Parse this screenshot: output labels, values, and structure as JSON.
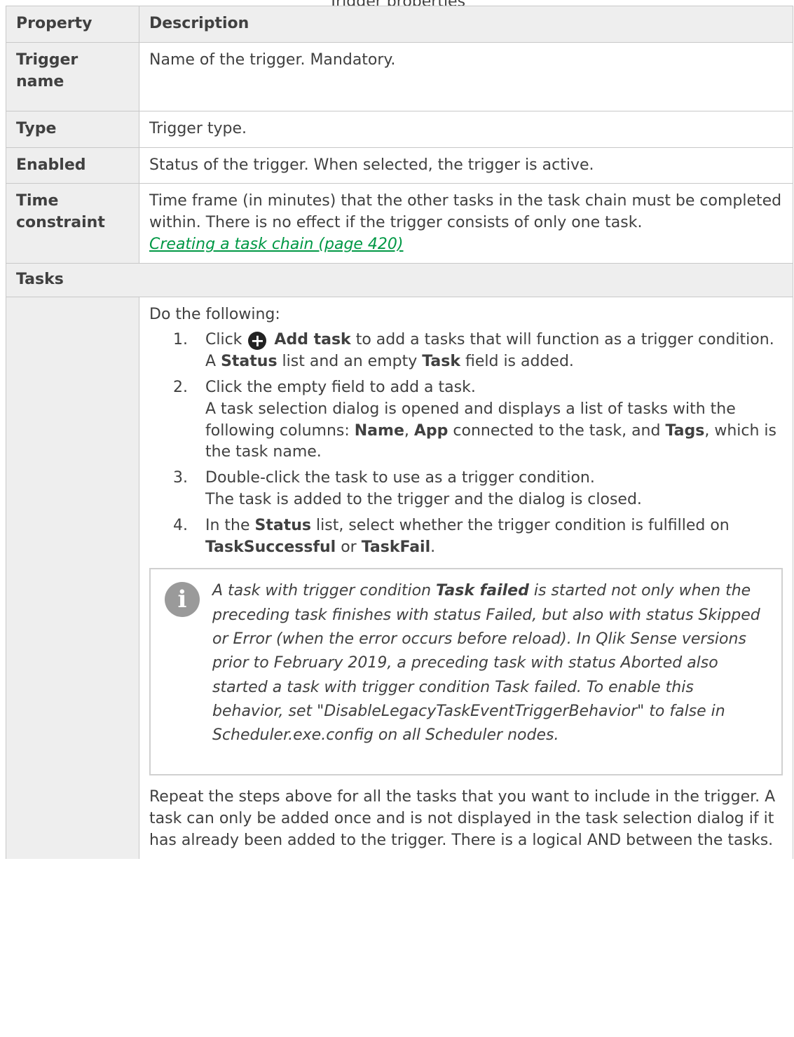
{
  "caption": "Trigger properties",
  "headers": {
    "property": "Property",
    "description": "Description"
  },
  "rows": [
    {
      "name": "Trigger name",
      "desc": "Name of the trigger. Mandatory."
    },
    {
      "name": "Type",
      "desc": "Trigger type."
    },
    {
      "name": "Enabled",
      "desc": "Status of the trigger. When selected, the trigger is active."
    }
  ],
  "time_constraint": {
    "name": "Time constraint",
    "desc": "Time frame (in minutes) that the other tasks in the task chain must be completed within. There is no effect if the trigger consists of only one task.",
    "link": "Creating a task chain (page 420)"
  },
  "tasks": {
    "section": "Tasks",
    "intro": "Do the following:",
    "steps": {
      "s1": {
        "num": "1.",
        "pre": "Click",
        "icon": "plus-circle-icon",
        "bold": "Add task",
        "post": "to add a tasks that will function as a trigger condition.",
        "sub_pre": "A",
        "sub_b1": "Status",
        "sub_mid": "list and an empty",
        "sub_b2": "Task",
        "sub_post": "field is added."
      },
      "s2": {
        "num": "2.",
        "text": "Click the empty field to add a task.",
        "sub_pre": "A task selection dialog is opened and displays a list of tasks with the following columns:",
        "b1": "Name",
        "b2": "App",
        "mid": "connected to the task, and",
        "b3": "Tags",
        "sub_post": "which is the task name."
      },
      "s3": {
        "num": "3.",
        "text": "Double-click the task to use as a trigger condition.",
        "sub": "The task is added to the trigger and the dialog is closed."
      },
      "s4": {
        "num": "4.",
        "pre": "In the",
        "b1": "Status",
        "mid": "list, select whether the trigger condition is fulfilled on",
        "b2": "TaskSuccessful",
        "or": "or",
        "b3": "TaskFail"
      }
    },
    "note": {
      "pre": "A task with trigger condition",
      "bold": "Task failed",
      "post": "is started not only when the preceding task finishes with status Failed, but also with status Skipped or Error (when the error occurs before reload). In Qlik Sense versions prior to February 2019, a preceding task with status Aborted also started a task with trigger condition Task failed. To enable this behavior, set \"DisableLegacyTaskEventTriggerBehavior\" to false in Scheduler.exe.config on all Scheduler nodes."
    },
    "outro": "Repeat the steps above for all the tasks that you want to include in the trigger. A task can only be added once and is not displayed in the task selection dialog if it has already been added to the trigger. There is a logical AND between the tasks."
  }
}
